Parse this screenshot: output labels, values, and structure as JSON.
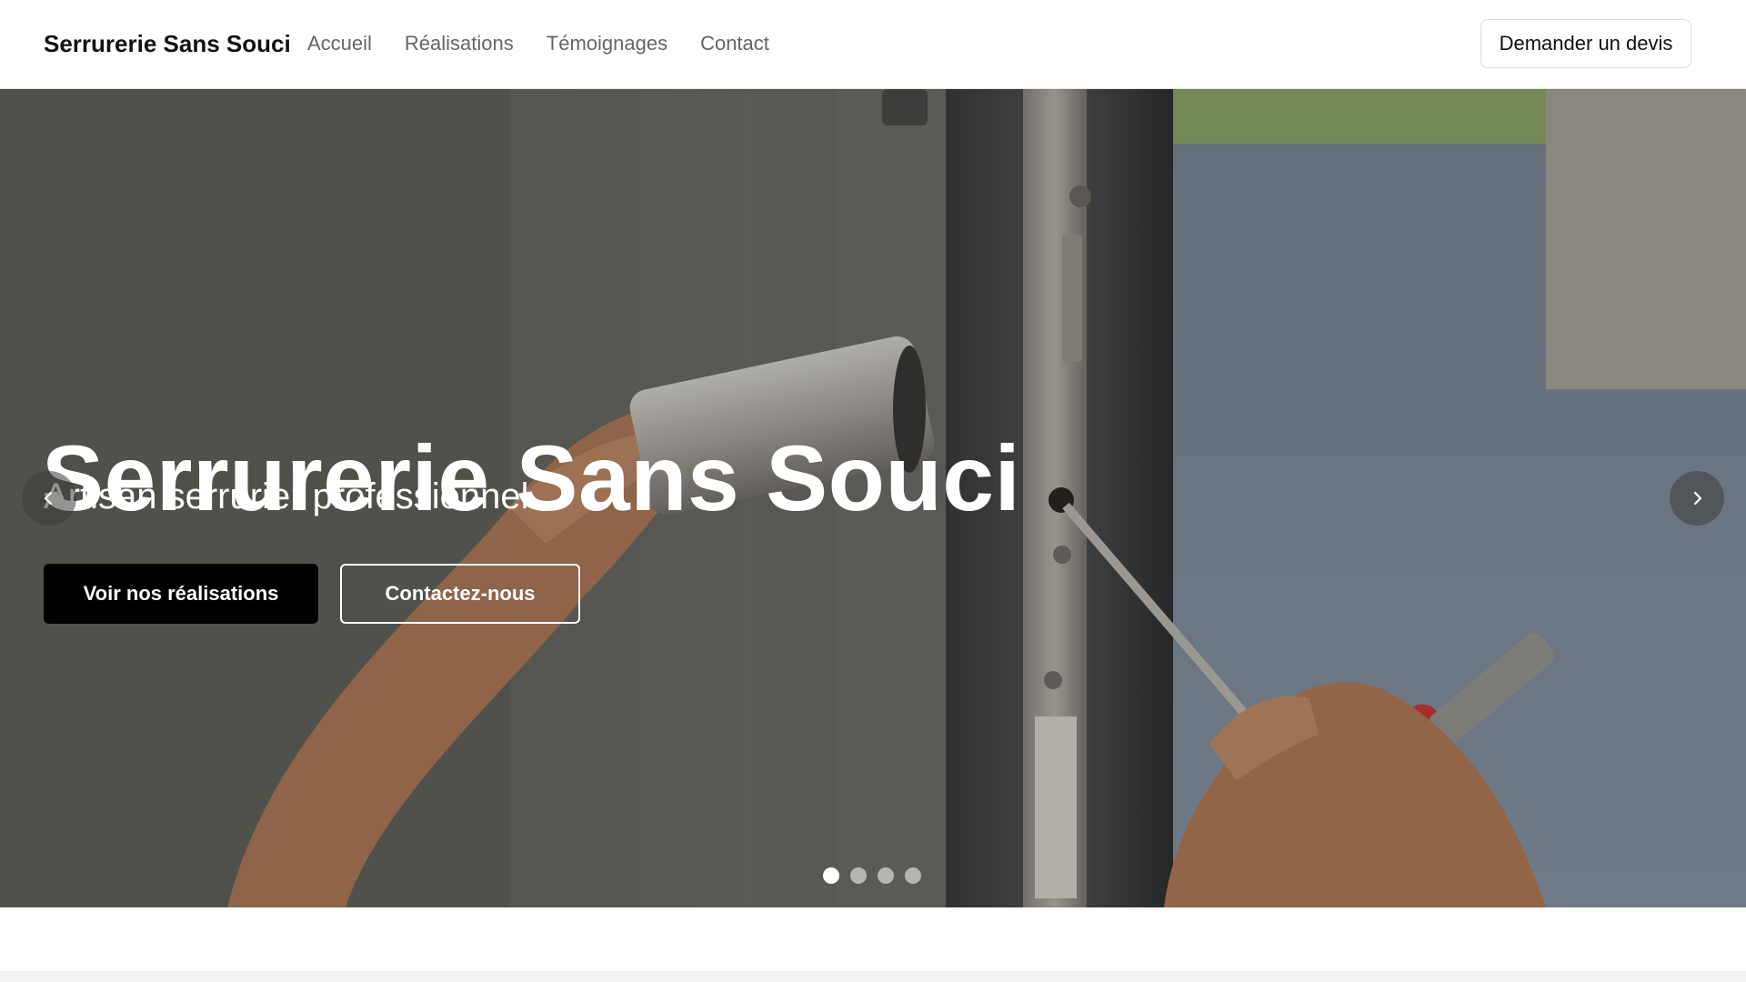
{
  "header": {
    "brand": "Serrurerie Sans Souci",
    "nav": [
      {
        "label": "Accueil"
      },
      {
        "label": "Réalisations"
      },
      {
        "label": "Témoignages"
      },
      {
        "label": "Contact"
      }
    ],
    "quote_button": "Demander un devis"
  },
  "hero": {
    "title": "Serrurerie Sans Souci",
    "subtitle": "Artisan serrurier professionnel",
    "primary_button": "Voir nos réalisations",
    "secondary_button": "Contactez-nous",
    "slides": {
      "count": 4,
      "active_index": 0
    },
    "prev_icon": "chevron-left-icon",
    "next_icon": "chevron-right-icon"
  },
  "colors": {
    "primary_button_bg": "#000000",
    "text_on_hero": "#ffffff",
    "nav_text": "#666666",
    "brand_text": "#111111"
  }
}
